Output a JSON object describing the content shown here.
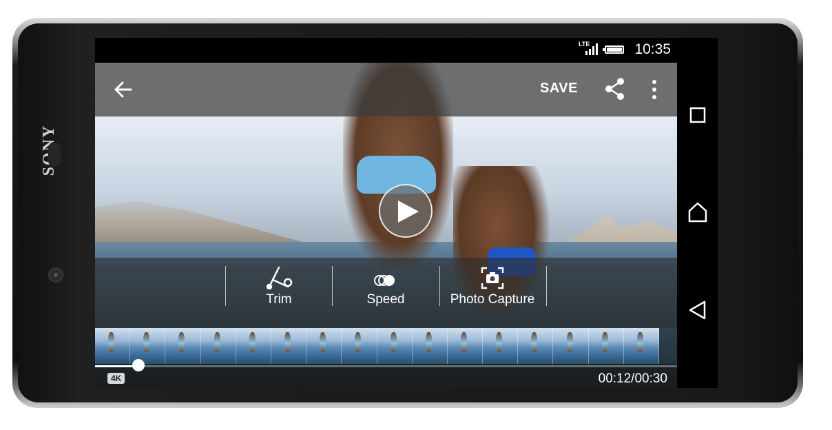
{
  "device": {
    "brand": "SONY"
  },
  "status_bar": {
    "network": "LTE",
    "time": "10:35"
  },
  "app_bar": {
    "back_icon": "arrow-left-icon",
    "save_label": "SAVE",
    "share_icon": "share-icon",
    "more_icon": "more-vert-icon"
  },
  "player": {
    "play_icon": "play-icon"
  },
  "tools": [
    {
      "label": "Trim",
      "icon": "scissors-icon"
    },
    {
      "label": "Speed",
      "icon": "speed-icon"
    },
    {
      "label": "Photo Capture",
      "icon": "camera-capture-icon"
    }
  ],
  "timeline": {
    "frame_count": 16
  },
  "playback": {
    "badge": "4K",
    "timecode": "00:12/00:30",
    "progress": 0.075
  },
  "nav_bar": {
    "recents_icon": "square-icon",
    "home_icon": "home-icon",
    "back_icon": "triangle-back-icon"
  },
  "colors": {
    "accent": "#ffffff",
    "toolbar_bg": "#2d2d2d",
    "shorts_light": "#6fb6e0",
    "shorts_dark": "#1e56c4"
  }
}
